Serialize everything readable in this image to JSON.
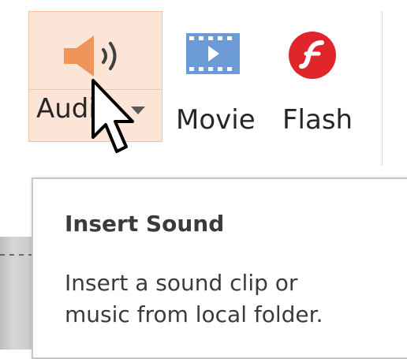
{
  "ribbon": {
    "buttons": [
      {
        "label": "Audio",
        "icon": "audio-speaker-icon",
        "has_dropdown": true,
        "state": "hover"
      },
      {
        "label": "Movie",
        "icon": "movie-filmstrip-icon"
      },
      {
        "label": "Flash",
        "icon": "flash-icon"
      }
    ]
  },
  "tooltip": {
    "title": "Insert Sound",
    "description_line1": "Insert a sound clip or",
    "description_line2": "music from local folder."
  },
  "colors": {
    "hover_bg": "#fce4d6",
    "speaker": "#f0955a",
    "movie": "#6d9bd6",
    "flash": "#e0262a",
    "accent": "#2b579a"
  }
}
